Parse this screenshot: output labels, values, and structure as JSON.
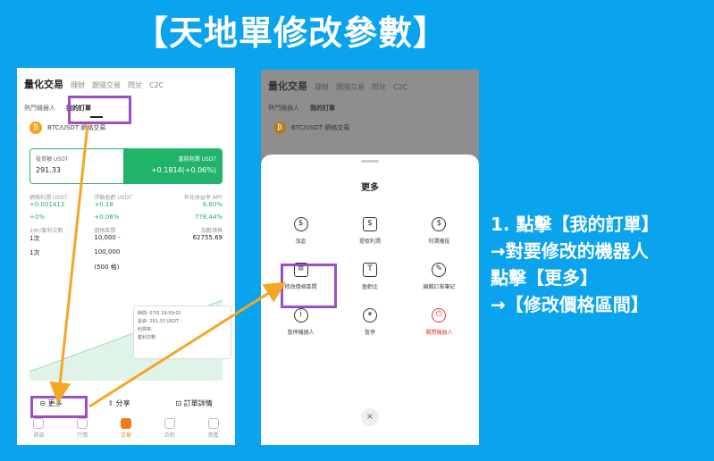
{
  "title": "【天地單修改參數】",
  "phone1": {
    "tabs": [
      "量化交易",
      "理財",
      "跟隨交易",
      "閃兌",
      "C2C"
    ],
    "subtabs": [
      "熱門機器人",
      "我的訂單"
    ],
    "coin_text": "BTC/USDT 網格交易",
    "pnl": {
      "left_label": "投資額 USDT",
      "left_value": "291.33",
      "right_label": "當前利潤 USDT",
      "right_value": "+0.1814(+0.06%)"
    },
    "stats": [
      [
        {
          "l": "網格利潤 USDT",
          "v": "+0.001413",
          "c": "green"
        },
        {
          "l": "浮動盈虧 USDT",
          "v": "+0.18",
          "c": "green"
        },
        {
          "l": "年化收益率 APY",
          "v": "6.60%",
          "c": "green"
        }
      ],
      [
        {
          "l": "",
          "v": "+0%",
          "c": "green"
        },
        {
          "l": "",
          "v": "+0.06%",
          "c": "green"
        },
        {
          "l": "",
          "v": "778.44%",
          "c": "green"
        }
      ],
      [
        {
          "l": "24h/套利次數",
          "v": "1次",
          "c": "dark"
        },
        {
          "l": "價格區間",
          "v": "10,000 -",
          "c": "dark"
        },
        {
          "l": "指數價格",
          "v": "62755.69",
          "c": "dark"
        }
      ],
      [
        {
          "l": "",
          "v": "1次",
          "c": "dark"
        },
        {
          "l": "",
          "v": "100,000",
          "c": "dark"
        },
        {
          "l": "",
          "v": "",
          "c": "dark"
        }
      ],
      [
        {
          "l": "",
          "v": "",
          "c": "dark"
        },
        {
          "l": "",
          "v": "(500 格)",
          "c": "dark"
        },
        {
          "l": "",
          "v": "",
          "c": "dark"
        }
      ]
    ],
    "tooltip": [
      "時間: 07日 19:59:02",
      "投資: 291.33 USDT",
      "利潤率:",
      "套利次數:"
    ],
    "actions": [
      "更多",
      "分享",
      "訂單詳情"
    ],
    "nav": [
      "首頁",
      "行情",
      "交易",
      "合約",
      "資產"
    ]
  },
  "phone2": {
    "tabs": [
      "量化交易",
      "理財",
      "跟隨交易",
      "閃兌",
      "C2C"
    ],
    "subtabs": [
      "熱門機器人",
      "我的訂單"
    ],
    "coin_text": "BTC/USDT 網格交易",
    "sheet_title": "更多",
    "items": [
      {
        "label": "加倉",
        "icon": "$"
      },
      {
        "label": "提取利潤",
        "icon": "$"
      },
      {
        "label": "利潤複投",
        "icon": "$"
      },
      {
        "label": "修改價格區間",
        "icon": "≡"
      },
      {
        "label": "盈虧比",
        "icon": "T"
      },
      {
        "label": "編輯訂單筆記",
        "icon": "✎"
      },
      {
        "label": "暫停機器人",
        "icon": "i"
      },
      {
        "label": "暫停",
        "icon": "⏸"
      },
      {
        "label": "關閉機器人",
        "icon": "⏻"
      }
    ],
    "close": "×"
  },
  "instructions": [
    "1. 點擊【我的訂單】",
    "→對要修改的機器人",
    "點擊【更多】",
    "→【修改價格區間】"
  ],
  "colors": {
    "background": "#0aa3ee",
    "highlight_box": "#9b4dca",
    "arrow": "#f5a623",
    "green": "#22b36a"
  }
}
